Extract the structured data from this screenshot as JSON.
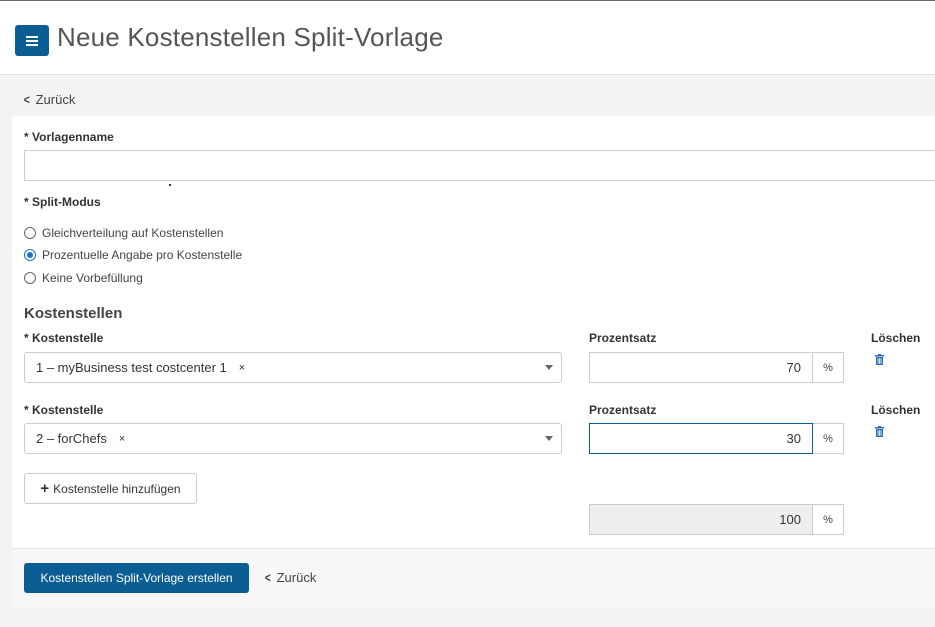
{
  "header": {
    "title": "Neue Kostenstellen Split-Vorlage",
    "menu_icon": "hamburger-icon"
  },
  "nav": {
    "back_label": "Zurück"
  },
  "form": {
    "name_label": "* Vorlagenname",
    "name_value": "",
    "split_mode_label": "* Split-Modus",
    "split_modes": [
      {
        "label": "Gleichverteilung auf Kostenstellen",
        "selected": false
      },
      {
        "label": "Prozentuelle Angabe pro Kostenstelle",
        "selected": true
      },
      {
        "label": "Keine Vorbefüllung",
        "selected": false
      }
    ]
  },
  "cost_centers": {
    "section_title": "Kostenstellen",
    "col_cost_center": "* Kostenstelle",
    "col_percent": "Prozentsatz",
    "col_delete": "Löschen",
    "rows": [
      {
        "value": "1 – myBusiness test costcenter 1",
        "remove": "×",
        "percent": "70",
        "unit": "%"
      },
      {
        "value": "2 – forChefs",
        "remove": "×",
        "percent": "30",
        "unit": "%"
      }
    ],
    "add_label": "Kostenstelle hinzufügen",
    "total": "100",
    "total_unit": "%"
  },
  "footer": {
    "submit_label": "Kostenstellen Split-Vorlage erstellen",
    "back_label": "Zurück"
  },
  "colors": {
    "accent": "#0a5e93",
    "radio": "#1a73c7"
  }
}
